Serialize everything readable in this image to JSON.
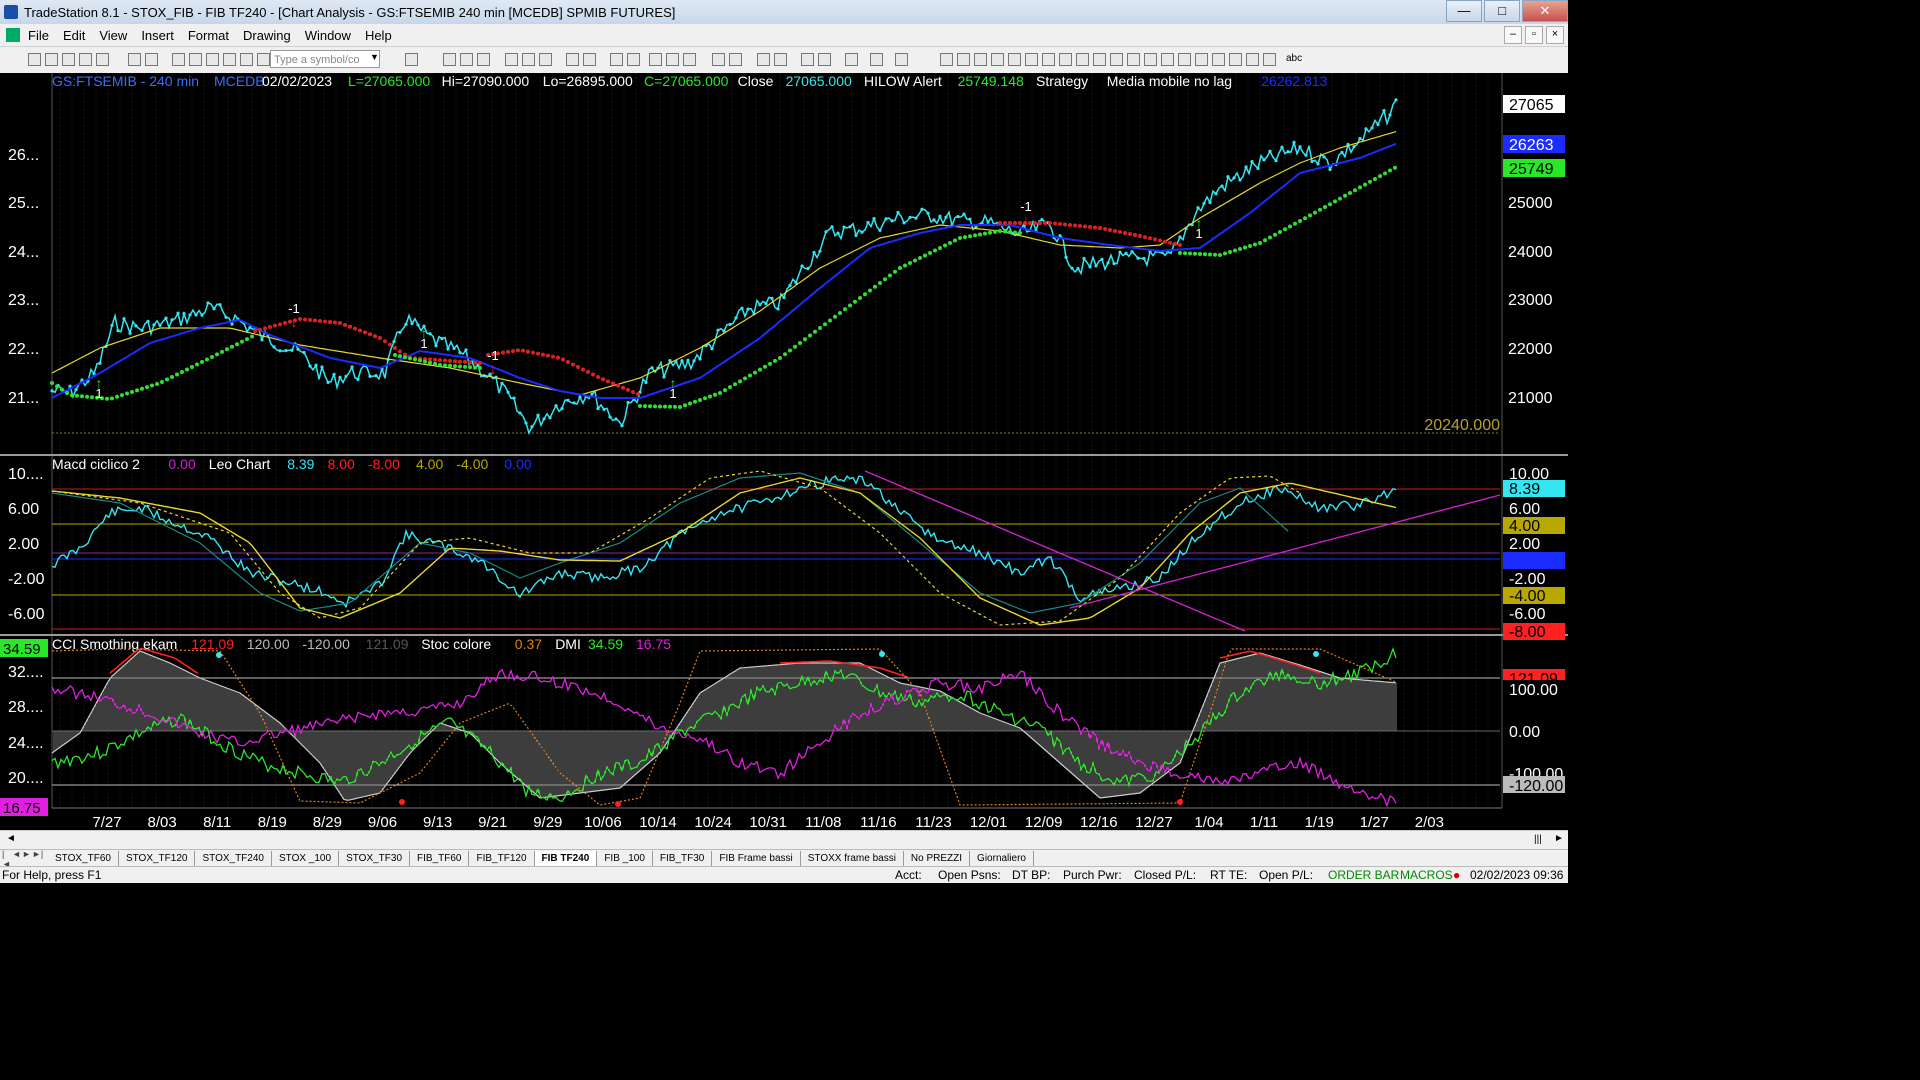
{
  "window": {
    "title": "TradeStation 8.1 - STOX_FIB - FIB TF240 - [Chart Analysis - GS:FTSEMIB  240 min  [MCEDB] SPMIB FUTURES]",
    "minimize": "—",
    "maximize": "□",
    "close": "✕"
  },
  "menu": [
    "File",
    "Edit",
    "View",
    "Insert",
    "Format",
    "Drawing",
    "Window",
    "Help"
  ],
  "toolbar": {
    "symbol_placeholder": "Type a symbol/co",
    "abc_label": "abc"
  },
  "price_panel": {
    "legend": [
      {
        "text": "GS:FTSEMIB - 240 min",
        "color": "#3a6cff"
      },
      {
        "text": "MCEDB",
        "color": "#3a6cff"
      },
      {
        "text": "02/02/2023",
        "color": "#ffffff"
      },
      {
        "text": "L=27065.000",
        "color": "#29e829"
      },
      {
        "text": "Hi=27090.000",
        "color": "#ffffff"
      },
      {
        "text": "Lo=26895.000",
        "color": "#ffffff"
      },
      {
        "text": "C=27065.000",
        "color": "#29e829"
      },
      {
        "text": "Close",
        "color": "#ffffff"
      },
      {
        "text": "27065.000",
        "color": "#34e6f2"
      },
      {
        "text": "HILOW Alert",
        "color": "#ffffff"
      },
      {
        "text": "25749.148",
        "color": "#29e829"
      },
      {
        "text": "Strategy",
        "color": "#ffffff"
      },
      {
        "text": "Media mobile no lag",
        "color": "#ffffff"
      },
      {
        "text": "26262.813",
        "color": "#1a2cff"
      }
    ],
    "yaxis_left": [
      "26...",
      "25...",
      "24...",
      "23...",
      "22...",
      "21..."
    ],
    "yaxis_right": [
      "25000",
      "24000",
      "23000",
      "22000",
      "21000"
    ],
    "right_tags": [
      {
        "text": "27065",
        "bg": "#ffffff",
        "fg": "#000000"
      },
      {
        "text": "26263",
        "bg": "#1a2cff",
        "fg": "#ffffff"
      },
      {
        "text": "25749",
        "bg": "#29e829",
        "fg": "#000000"
      }
    ],
    "bottom_value": "20240.000",
    "signals": [
      "-1",
      "1",
      "1",
      "-1",
      "1",
      "-1",
      "1"
    ]
  },
  "macd_panel": {
    "legend": [
      {
        "text": "Macd ciclico 2",
        "color": "#ffffff"
      },
      {
        "text": "0.00",
        "color": "#cc22cc"
      },
      {
        "text": "Leo Chart",
        "color": "#ffffff"
      },
      {
        "text": "8.39",
        "color": "#34e6f2"
      },
      {
        "text": "8.00",
        "color": "#ff2020"
      },
      {
        "text": "-8.00",
        "color": "#ff2020"
      },
      {
        "text": "4.00",
        "color": "#b8a800"
      },
      {
        "text": "-4.00",
        "color": "#b8a800"
      },
      {
        "text": "0.00",
        "color": "#1a2cff"
      }
    ],
    "yaxis_left": [
      "10....",
      "6.00",
      "2.00",
      "-2.00",
      "-6.00"
    ],
    "right_tags": [
      {
        "text": "10.00",
        "bg": "#000000",
        "fg": "#ffffff"
      },
      {
        "text": "8.39",
        "bg": "#34e6f2",
        "fg": "#000000"
      },
      {
        "text": "6.00",
        "bg": "#000000",
        "fg": "#ffffff"
      },
      {
        "text": "4.00",
        "bg": "#b8a800",
        "fg": "#000000"
      },
      {
        "text": "2.00",
        "bg": "#000000",
        "fg": "#ffffff"
      },
      {
        "text": "0.00",
        "bg": "#1a2cff",
        "fg": "#1a2cff"
      },
      {
        "text": "-2.00",
        "bg": "#000000",
        "fg": "#ffffff"
      },
      {
        "text": "-4.00",
        "bg": "#b8a800",
        "fg": "#000000"
      },
      {
        "text": "-6.00",
        "bg": "#000000",
        "fg": "#ffffff"
      },
      {
        "text": "-8.00",
        "bg": "#ff2020",
        "fg": "#000000"
      }
    ]
  },
  "cci_panel": {
    "legend": [
      {
        "text": "CCI Smothing ekam",
        "color": "#ffffff"
      },
      {
        "text": "121.09",
        "color": "#ff2020"
      },
      {
        "text": "120.00",
        "color": "#bbbbbb"
      },
      {
        "text": "-120.00",
        "color": "#bbbbbb"
      },
      {
        "text": "121.09",
        "color": "#555555"
      },
      {
        "text": "Stoc colore",
        "color": "#ffffff"
      },
      {
        "text": "0.37",
        "color": "#e08020"
      },
      {
        "text": "DMI",
        "color": "#ffffff"
      },
      {
        "text": "34.59",
        "color": "#29e829"
      },
      {
        "text": "16.75",
        "color": "#e020e0"
      }
    ],
    "yaxis_left": [
      "32....",
      "28....",
      "24....",
      "20...."
    ],
    "left_tags": [
      {
        "text": "34.59",
        "bg": "#29e829"
      },
      {
        "text": "16.75",
        "bg": "#e020e0"
      }
    ],
    "right_tags": [
      {
        "text": "121.09",
        "bg": "#ff2020",
        "fg": "#000000"
      },
      {
        "text": "100.00",
        "bg": "#000000",
        "fg": "#ffffff"
      },
      {
        "text": "0.00",
        "bg": "#000000",
        "fg": "#ffffff"
      },
      {
        "text": "-100.00",
        "bg": "#000000",
        "fg": "#ffffff"
      },
      {
        "text": "-120.00",
        "bg": "#bbbbbb",
        "fg": "#000000"
      }
    ]
  },
  "xaxis": [
    "7/27",
    "8/03",
    "8/11",
    "8/19",
    "8/29",
    "9/06",
    "9/13",
    "9/21",
    "9/29",
    "10/06",
    "10/14",
    "10/24",
    "10/31",
    "11/08",
    "11/16",
    "11/23",
    "12/01",
    "12/09",
    "12/16",
    "12/27",
    "1/04",
    "1/11",
    "1/19",
    "1/27",
    "2/03"
  ],
  "tabs": [
    "STOX_TF60",
    "STOX_TF120",
    "STOX_TF240",
    "STOX _100",
    "STOX_TF30",
    "FIB_TF60",
    "FIB_TF120",
    "FIB TF240",
    "FIB _100",
    "FIB_TF30",
    "FIB Frame bassi",
    "STOXX frame bassi",
    "No PREZZI",
    "Giornaliero"
  ],
  "active_tab": "FIB TF240",
  "status": {
    "help": "For Help, press F1",
    "acct": "Acct:",
    "open_psns": "Open Psns:",
    "dt_bp": "DT BP:",
    "purch_pwr": "Purch Pwr:",
    "closed_pl": "Closed P/L:",
    "rt_te": "RT TE:",
    "open_pl": "Open P/L:",
    "order_bar": "ORDER BAR",
    "macros": "MACROS",
    "datetime": "02/02/2023 09:36"
  }
}
